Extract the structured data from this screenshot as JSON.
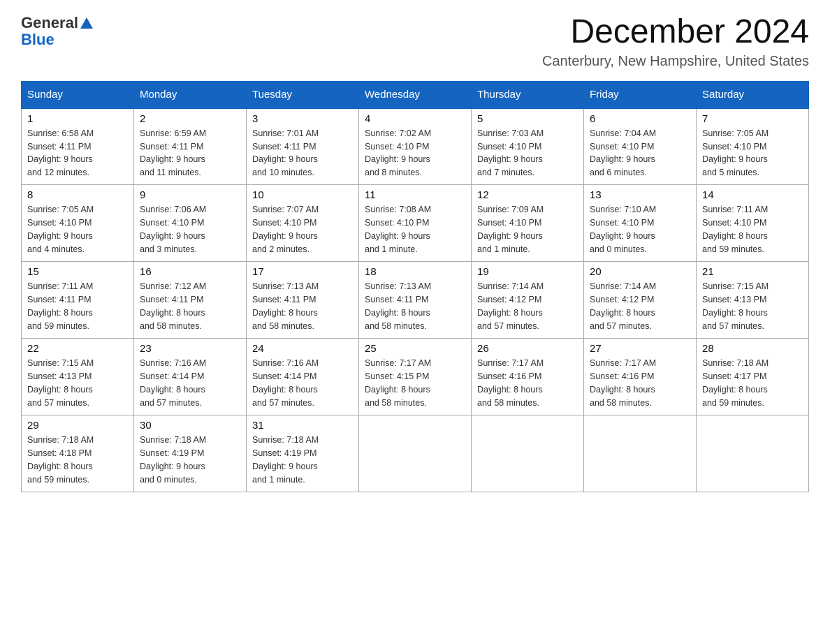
{
  "header": {
    "logo_general": "General",
    "logo_blue": "Blue",
    "month": "December 2024",
    "location": "Canterbury, New Hampshire, United States"
  },
  "days_of_week": [
    "Sunday",
    "Monday",
    "Tuesday",
    "Wednesday",
    "Thursday",
    "Friday",
    "Saturday"
  ],
  "weeks": [
    [
      {
        "day": "1",
        "info": "Sunrise: 6:58 AM\nSunset: 4:11 PM\nDaylight: 9 hours\nand 12 minutes."
      },
      {
        "day": "2",
        "info": "Sunrise: 6:59 AM\nSunset: 4:11 PM\nDaylight: 9 hours\nand 11 minutes."
      },
      {
        "day": "3",
        "info": "Sunrise: 7:01 AM\nSunset: 4:11 PM\nDaylight: 9 hours\nand 10 minutes."
      },
      {
        "day": "4",
        "info": "Sunrise: 7:02 AM\nSunset: 4:10 PM\nDaylight: 9 hours\nand 8 minutes."
      },
      {
        "day": "5",
        "info": "Sunrise: 7:03 AM\nSunset: 4:10 PM\nDaylight: 9 hours\nand 7 minutes."
      },
      {
        "day": "6",
        "info": "Sunrise: 7:04 AM\nSunset: 4:10 PM\nDaylight: 9 hours\nand 6 minutes."
      },
      {
        "day": "7",
        "info": "Sunrise: 7:05 AM\nSunset: 4:10 PM\nDaylight: 9 hours\nand 5 minutes."
      }
    ],
    [
      {
        "day": "8",
        "info": "Sunrise: 7:05 AM\nSunset: 4:10 PM\nDaylight: 9 hours\nand 4 minutes."
      },
      {
        "day": "9",
        "info": "Sunrise: 7:06 AM\nSunset: 4:10 PM\nDaylight: 9 hours\nand 3 minutes."
      },
      {
        "day": "10",
        "info": "Sunrise: 7:07 AM\nSunset: 4:10 PM\nDaylight: 9 hours\nand 2 minutes."
      },
      {
        "day": "11",
        "info": "Sunrise: 7:08 AM\nSunset: 4:10 PM\nDaylight: 9 hours\nand 1 minute."
      },
      {
        "day": "12",
        "info": "Sunrise: 7:09 AM\nSunset: 4:10 PM\nDaylight: 9 hours\nand 1 minute."
      },
      {
        "day": "13",
        "info": "Sunrise: 7:10 AM\nSunset: 4:10 PM\nDaylight: 9 hours\nand 0 minutes."
      },
      {
        "day": "14",
        "info": "Sunrise: 7:11 AM\nSunset: 4:10 PM\nDaylight: 8 hours\nand 59 minutes."
      }
    ],
    [
      {
        "day": "15",
        "info": "Sunrise: 7:11 AM\nSunset: 4:11 PM\nDaylight: 8 hours\nand 59 minutes."
      },
      {
        "day": "16",
        "info": "Sunrise: 7:12 AM\nSunset: 4:11 PM\nDaylight: 8 hours\nand 58 minutes."
      },
      {
        "day": "17",
        "info": "Sunrise: 7:13 AM\nSunset: 4:11 PM\nDaylight: 8 hours\nand 58 minutes."
      },
      {
        "day": "18",
        "info": "Sunrise: 7:13 AM\nSunset: 4:11 PM\nDaylight: 8 hours\nand 58 minutes."
      },
      {
        "day": "19",
        "info": "Sunrise: 7:14 AM\nSunset: 4:12 PM\nDaylight: 8 hours\nand 57 minutes."
      },
      {
        "day": "20",
        "info": "Sunrise: 7:14 AM\nSunset: 4:12 PM\nDaylight: 8 hours\nand 57 minutes."
      },
      {
        "day": "21",
        "info": "Sunrise: 7:15 AM\nSunset: 4:13 PM\nDaylight: 8 hours\nand 57 minutes."
      }
    ],
    [
      {
        "day": "22",
        "info": "Sunrise: 7:15 AM\nSunset: 4:13 PM\nDaylight: 8 hours\nand 57 minutes."
      },
      {
        "day": "23",
        "info": "Sunrise: 7:16 AM\nSunset: 4:14 PM\nDaylight: 8 hours\nand 57 minutes."
      },
      {
        "day": "24",
        "info": "Sunrise: 7:16 AM\nSunset: 4:14 PM\nDaylight: 8 hours\nand 57 minutes."
      },
      {
        "day": "25",
        "info": "Sunrise: 7:17 AM\nSunset: 4:15 PM\nDaylight: 8 hours\nand 58 minutes."
      },
      {
        "day": "26",
        "info": "Sunrise: 7:17 AM\nSunset: 4:16 PM\nDaylight: 8 hours\nand 58 minutes."
      },
      {
        "day": "27",
        "info": "Sunrise: 7:17 AM\nSunset: 4:16 PM\nDaylight: 8 hours\nand 58 minutes."
      },
      {
        "day": "28",
        "info": "Sunrise: 7:18 AM\nSunset: 4:17 PM\nDaylight: 8 hours\nand 59 minutes."
      }
    ],
    [
      {
        "day": "29",
        "info": "Sunrise: 7:18 AM\nSunset: 4:18 PM\nDaylight: 8 hours\nand 59 minutes."
      },
      {
        "day": "30",
        "info": "Sunrise: 7:18 AM\nSunset: 4:19 PM\nDaylight: 9 hours\nand 0 minutes."
      },
      {
        "day": "31",
        "info": "Sunrise: 7:18 AM\nSunset: 4:19 PM\nDaylight: 9 hours\nand 1 minute."
      },
      {
        "day": "",
        "info": ""
      },
      {
        "day": "",
        "info": ""
      },
      {
        "day": "",
        "info": ""
      },
      {
        "day": "",
        "info": ""
      }
    ]
  ]
}
